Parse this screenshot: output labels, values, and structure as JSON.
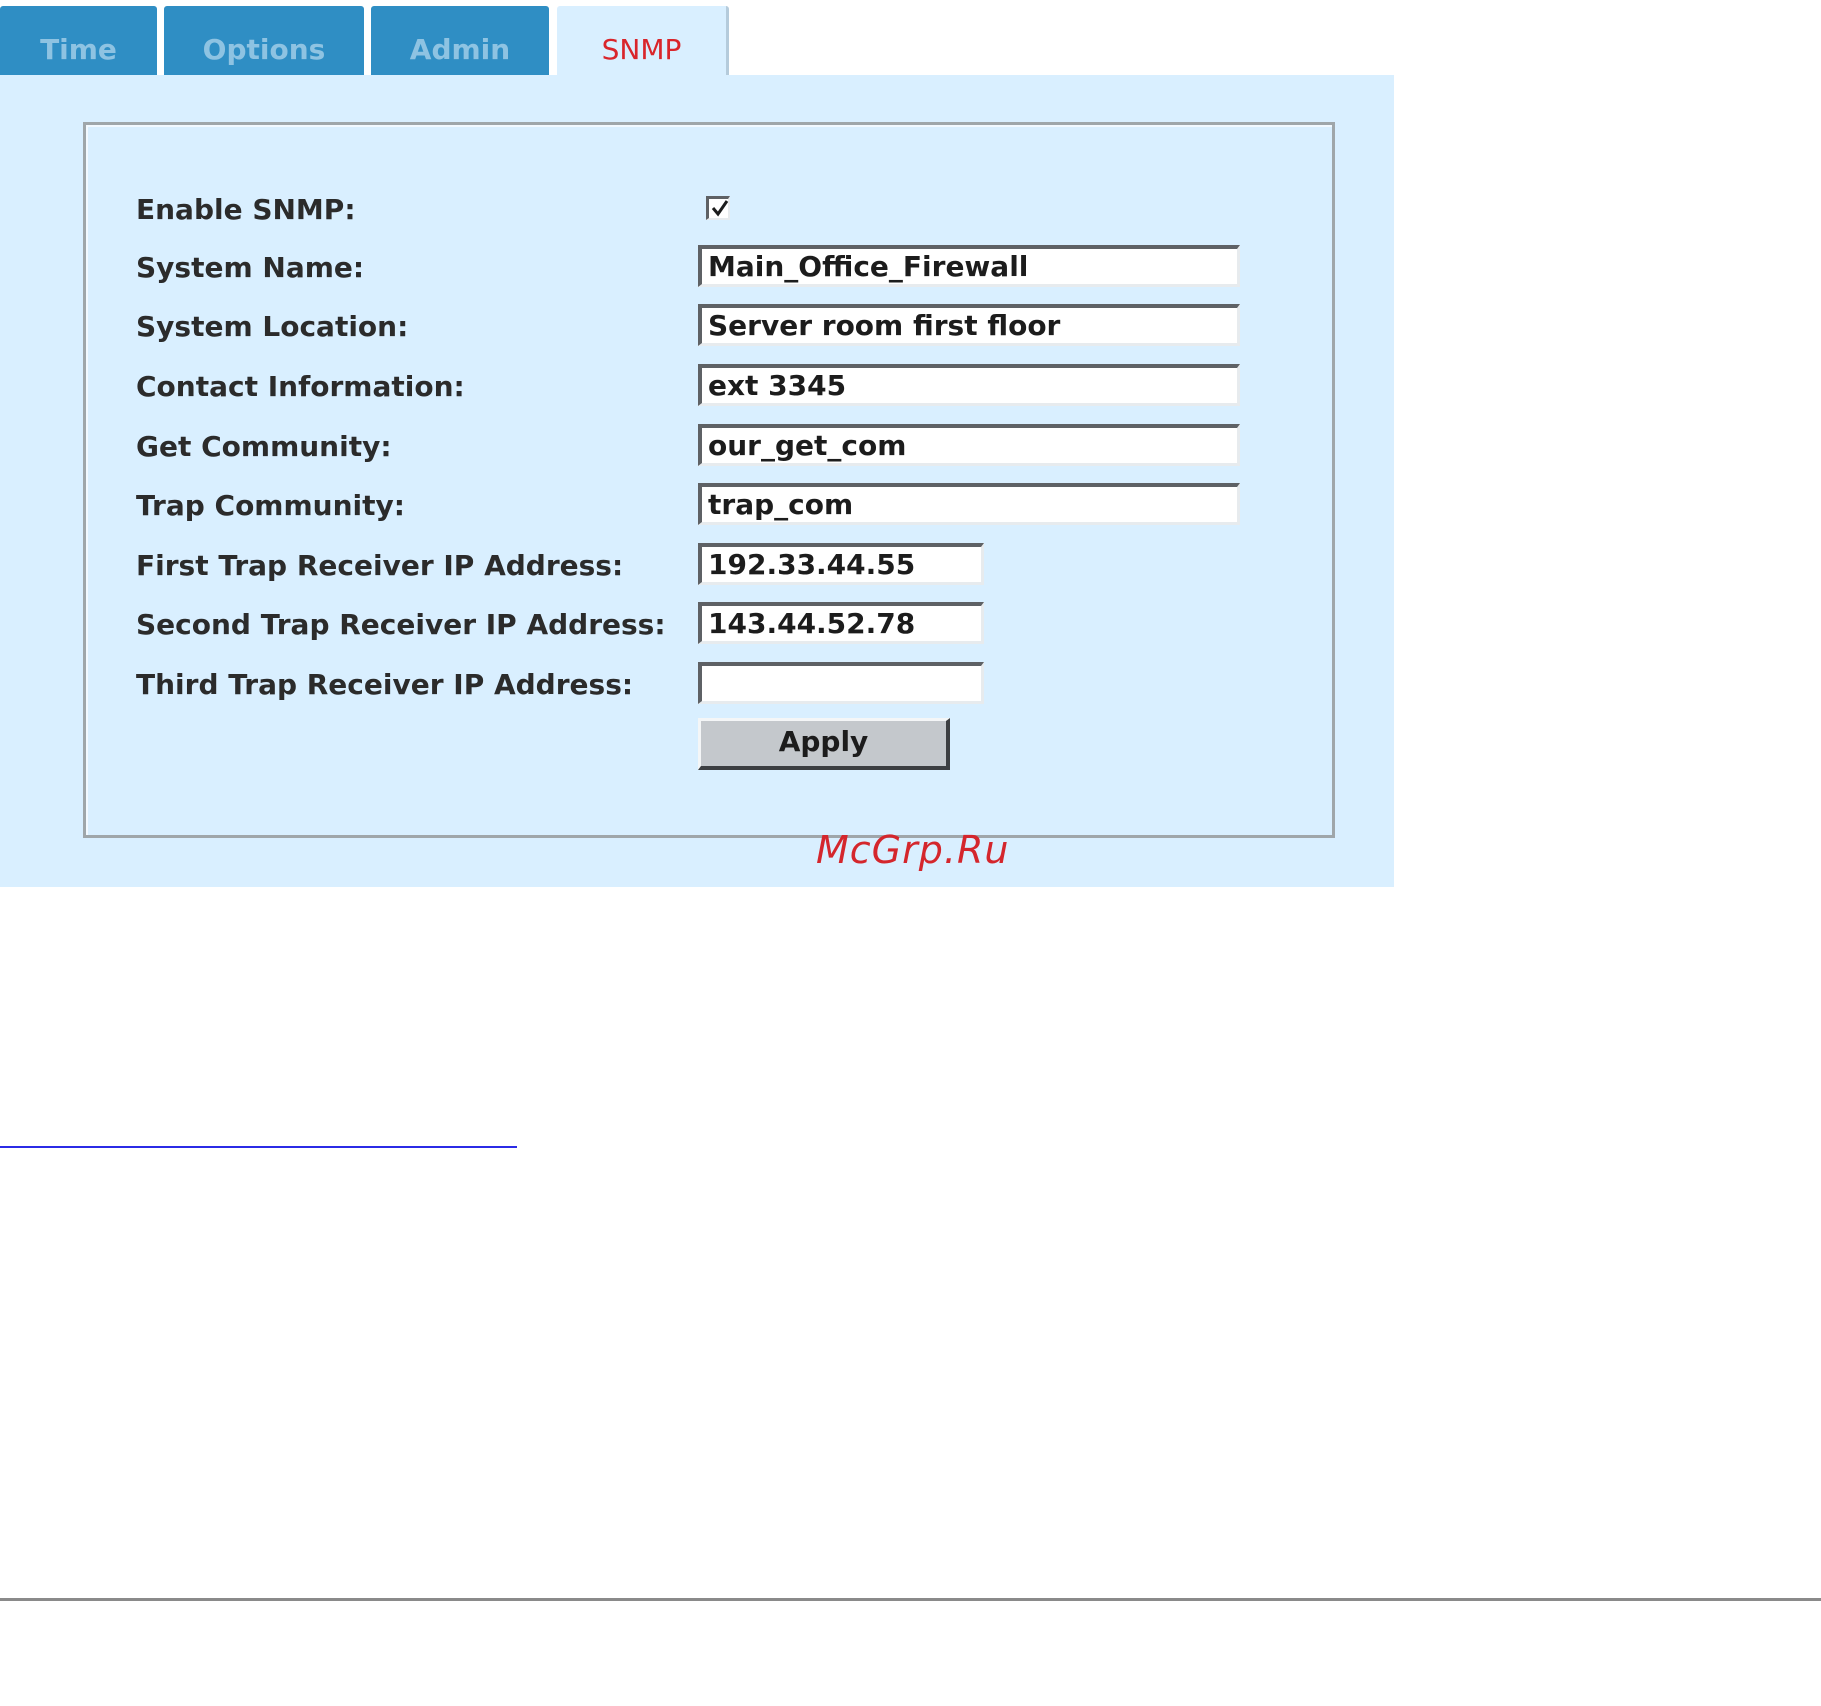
{
  "tabs": [
    {
      "label": "Time",
      "active": false
    },
    {
      "label": "Options",
      "active": false
    },
    {
      "label": "Admin",
      "active": false
    },
    {
      "label": "SNMP",
      "active": true
    }
  ],
  "form": {
    "enable_snmp": {
      "label": "Enable SNMP:",
      "checked": true
    },
    "system_name": {
      "label": "System Name:",
      "value": "Main_Office_Firewall"
    },
    "system_location": {
      "label": "System Location:",
      "value": "Server room first floor"
    },
    "contact_information": {
      "label": "Contact Information:",
      "value": "ext 3345"
    },
    "get_community": {
      "label": "Get Community:",
      "value": "our_get_com"
    },
    "trap_community": {
      "label": "Trap Community:",
      "value": "trap_com"
    },
    "first_trap_receiver": {
      "label": "First Trap Receiver IP Address:",
      "value": "192.33.44.55"
    },
    "second_trap_receiver": {
      "label": "Second Trap Receiver IP Address:",
      "value": "143.44.52.78"
    },
    "third_trap_receiver": {
      "label": "Third Trap Receiver IP Address:",
      "value": ""
    },
    "apply_label": "Apply"
  },
  "watermark": "McGrp.Ru",
  "colors": {
    "tab_inactive_bg": "#2f8ec4",
    "tab_inactive_text": "#8ec3e2",
    "tab_active_text": "#d9252b",
    "panel_bg": "#d9efff",
    "watermark": "#d4262c"
  }
}
